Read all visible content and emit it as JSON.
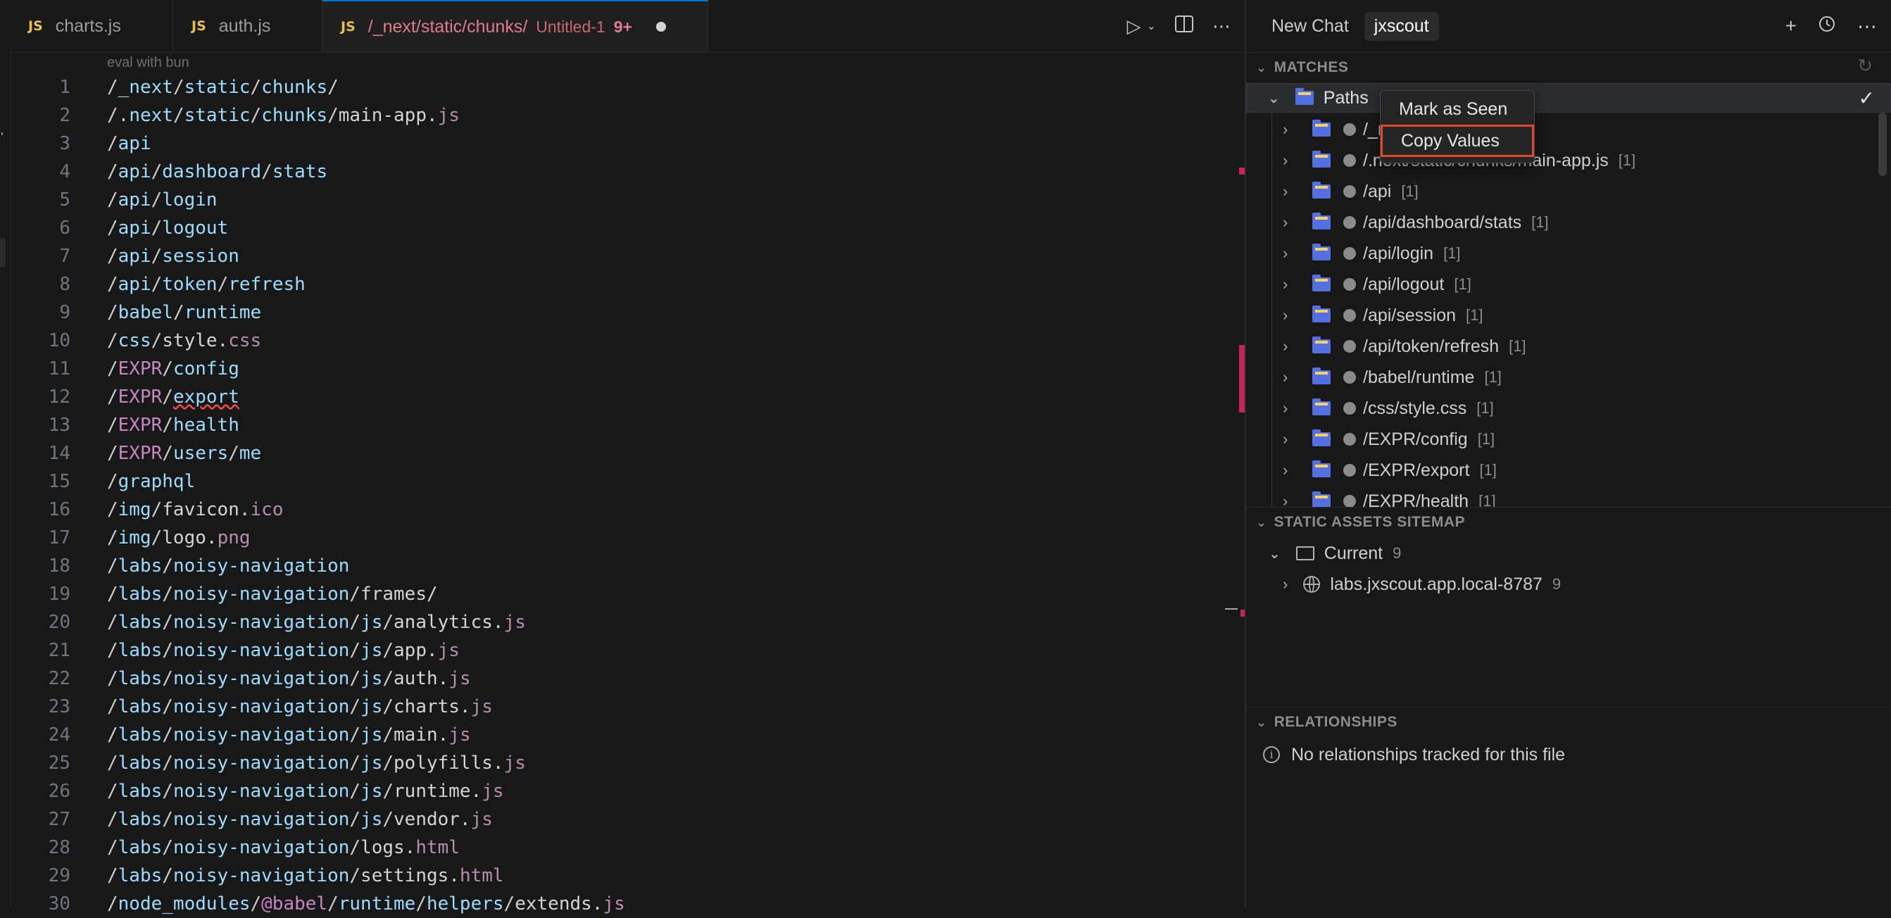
{
  "tabs": [
    {
      "label": "charts.js",
      "icon": "JS"
    },
    {
      "label": "auth.js",
      "icon": "JS"
    },
    {
      "label": "/_next/static/chunks/",
      "sub": "Untitled-1",
      "badge": "9+",
      "icon": "JS"
    }
  ],
  "editor": {
    "hint": "eval with bun",
    "lines": [
      {
        "n": "1",
        "segs": [
          [
            "slash",
            "/"
          ],
          [
            "seg",
            "_next"
          ],
          [
            "slash",
            "/"
          ],
          [
            "seg",
            "static"
          ],
          [
            "slash",
            "/"
          ],
          [
            "seg",
            "chunks"
          ],
          [
            "slash",
            "/"
          ]
        ]
      },
      {
        "n": "2",
        "segs": [
          [
            "slash",
            "/."
          ],
          [
            "seg",
            "next"
          ],
          [
            "slash",
            "/"
          ],
          [
            "seg",
            "static"
          ],
          [
            "slash",
            "/"
          ],
          [
            "seg",
            "chunks"
          ],
          [
            "slash",
            "/"
          ],
          [
            "w",
            "main-app."
          ],
          [
            "ext",
            "js"
          ]
        ]
      },
      {
        "n": "3",
        "segs": [
          [
            "slash",
            "/"
          ],
          [
            "seg",
            "api"
          ]
        ]
      },
      {
        "n": "4",
        "segs": [
          [
            "slash",
            "/"
          ],
          [
            "seg",
            "api"
          ],
          [
            "slash",
            "/"
          ],
          [
            "seg",
            "dashboard"
          ],
          [
            "slash",
            "/"
          ],
          [
            "seg",
            "stats"
          ]
        ]
      },
      {
        "n": "5",
        "segs": [
          [
            "slash",
            "/"
          ],
          [
            "seg",
            "api"
          ],
          [
            "slash",
            "/"
          ],
          [
            "seg",
            "login"
          ]
        ]
      },
      {
        "n": "6",
        "segs": [
          [
            "slash",
            "/"
          ],
          [
            "seg",
            "api"
          ],
          [
            "slash",
            "/"
          ],
          [
            "seg",
            "logout"
          ]
        ]
      },
      {
        "n": "7",
        "segs": [
          [
            "slash",
            "/"
          ],
          [
            "seg",
            "api"
          ],
          [
            "slash",
            "/"
          ],
          [
            "seg",
            "session"
          ]
        ]
      },
      {
        "n": "8",
        "segs": [
          [
            "slash",
            "/"
          ],
          [
            "seg",
            "api"
          ],
          [
            "slash",
            "/"
          ],
          [
            "seg",
            "token"
          ],
          [
            "slash",
            "/"
          ],
          [
            "seg",
            "refresh"
          ]
        ]
      },
      {
        "n": "9",
        "segs": [
          [
            "slash",
            "/"
          ],
          [
            "seg",
            "babel"
          ],
          [
            "slash",
            "/"
          ],
          [
            "seg",
            "runtime"
          ]
        ]
      },
      {
        "n": "10",
        "segs": [
          [
            "slash",
            "/"
          ],
          [
            "seg",
            "css"
          ],
          [
            "slash",
            "/"
          ],
          [
            "w",
            "style."
          ],
          [
            "ext",
            "css"
          ]
        ]
      },
      {
        "n": "11",
        "segs": [
          [
            "slash",
            "/"
          ],
          [
            "p",
            "EXPR"
          ],
          [
            "slash",
            "/"
          ],
          [
            "seg",
            "config"
          ]
        ]
      },
      {
        "n": "12",
        "segs": [
          [
            "slash",
            "/"
          ],
          [
            "p",
            "EXPR"
          ],
          [
            "slash",
            "/"
          ],
          [
            "und",
            "export"
          ]
        ]
      },
      {
        "n": "13",
        "segs": [
          [
            "slash",
            "/"
          ],
          [
            "p",
            "EXPR"
          ],
          [
            "slash",
            "/"
          ],
          [
            "seg",
            "health"
          ]
        ]
      },
      {
        "n": "14",
        "segs": [
          [
            "slash",
            "/"
          ],
          [
            "p",
            "EXPR"
          ],
          [
            "slash",
            "/"
          ],
          [
            "seg",
            "users"
          ],
          [
            "slash",
            "/"
          ],
          [
            "seg",
            "me"
          ]
        ]
      },
      {
        "n": "15",
        "segs": [
          [
            "slash",
            "/"
          ],
          [
            "seg",
            "graphql"
          ]
        ]
      },
      {
        "n": "16",
        "segs": [
          [
            "slash",
            "/"
          ],
          [
            "seg",
            "img"
          ],
          [
            "slash",
            "/"
          ],
          [
            "w",
            "favicon."
          ],
          [
            "ext",
            "ico"
          ]
        ]
      },
      {
        "n": "17",
        "segs": [
          [
            "slash",
            "/"
          ],
          [
            "seg",
            "img"
          ],
          [
            "slash",
            "/"
          ],
          [
            "w",
            "logo."
          ],
          [
            "ext",
            "png"
          ]
        ]
      },
      {
        "n": "18",
        "segs": [
          [
            "slash",
            "/"
          ],
          [
            "seg",
            "labs"
          ],
          [
            "slash",
            "/"
          ],
          [
            "seg",
            "noisy-navigation"
          ]
        ]
      },
      {
        "n": "19",
        "segs": [
          [
            "slash",
            "/"
          ],
          [
            "seg",
            "labs"
          ],
          [
            "slash",
            "/"
          ],
          [
            "seg",
            "noisy-navigation"
          ],
          [
            "slash",
            "/"
          ],
          [
            "w",
            "frames/"
          ]
        ]
      },
      {
        "n": "20",
        "segs": [
          [
            "slash",
            "/"
          ],
          [
            "seg",
            "labs"
          ],
          [
            "slash",
            "/"
          ],
          [
            "seg",
            "noisy-navigation"
          ],
          [
            "slash",
            "/"
          ],
          [
            "seg",
            "js"
          ],
          [
            "slash",
            "/"
          ],
          [
            "w",
            "analytics."
          ],
          [
            "ext",
            "js"
          ]
        ]
      },
      {
        "n": "21",
        "segs": [
          [
            "slash",
            "/"
          ],
          [
            "seg",
            "labs"
          ],
          [
            "slash",
            "/"
          ],
          [
            "seg",
            "noisy-navigation"
          ],
          [
            "slash",
            "/"
          ],
          [
            "seg",
            "js"
          ],
          [
            "slash",
            "/"
          ],
          [
            "w",
            "app."
          ],
          [
            "ext",
            "js"
          ]
        ]
      },
      {
        "n": "22",
        "segs": [
          [
            "slash",
            "/"
          ],
          [
            "seg",
            "labs"
          ],
          [
            "slash",
            "/"
          ],
          [
            "seg",
            "noisy-navigation"
          ],
          [
            "slash",
            "/"
          ],
          [
            "seg",
            "js"
          ],
          [
            "slash",
            "/"
          ],
          [
            "w",
            "auth."
          ],
          [
            "ext",
            "js"
          ]
        ]
      },
      {
        "n": "23",
        "segs": [
          [
            "slash",
            "/"
          ],
          [
            "seg",
            "labs"
          ],
          [
            "slash",
            "/"
          ],
          [
            "seg",
            "noisy-navigation"
          ],
          [
            "slash",
            "/"
          ],
          [
            "seg",
            "js"
          ],
          [
            "slash",
            "/"
          ],
          [
            "w",
            "charts."
          ],
          [
            "ext",
            "js"
          ]
        ]
      },
      {
        "n": "24",
        "segs": [
          [
            "slash",
            "/"
          ],
          [
            "seg",
            "labs"
          ],
          [
            "slash",
            "/"
          ],
          [
            "seg",
            "noisy-navigation"
          ],
          [
            "slash",
            "/"
          ],
          [
            "seg",
            "js"
          ],
          [
            "slash",
            "/"
          ],
          [
            "w",
            "main."
          ],
          [
            "ext",
            "js"
          ]
        ]
      },
      {
        "n": "25",
        "segs": [
          [
            "slash",
            "/"
          ],
          [
            "seg",
            "labs"
          ],
          [
            "slash",
            "/"
          ],
          [
            "seg",
            "noisy-navigation"
          ],
          [
            "slash",
            "/"
          ],
          [
            "seg",
            "js"
          ],
          [
            "slash",
            "/"
          ],
          [
            "w",
            "polyfills."
          ],
          [
            "ext",
            "js"
          ]
        ]
      },
      {
        "n": "26",
        "segs": [
          [
            "slash",
            "/"
          ],
          [
            "seg",
            "labs"
          ],
          [
            "slash",
            "/"
          ],
          [
            "seg",
            "noisy-navigation"
          ],
          [
            "slash",
            "/"
          ],
          [
            "seg",
            "js"
          ],
          [
            "slash",
            "/"
          ],
          [
            "w",
            "runtime."
          ],
          [
            "ext",
            "js"
          ]
        ]
      },
      {
        "n": "27",
        "segs": [
          [
            "slash",
            "/"
          ],
          [
            "seg",
            "labs"
          ],
          [
            "slash",
            "/"
          ],
          [
            "seg",
            "noisy-navigation"
          ],
          [
            "slash",
            "/"
          ],
          [
            "seg",
            "js"
          ],
          [
            "slash",
            "/"
          ],
          [
            "w",
            "vendor."
          ],
          [
            "ext",
            "js"
          ]
        ]
      },
      {
        "n": "28",
        "segs": [
          [
            "slash",
            "/"
          ],
          [
            "seg",
            "labs"
          ],
          [
            "slash",
            "/"
          ],
          [
            "seg",
            "noisy-navigation"
          ],
          [
            "slash",
            "/"
          ],
          [
            "w",
            "logs."
          ],
          [
            "ext",
            "html"
          ]
        ]
      },
      {
        "n": "29",
        "segs": [
          [
            "slash",
            "/"
          ],
          [
            "seg",
            "labs"
          ],
          [
            "slash",
            "/"
          ],
          [
            "seg",
            "noisy-navigation"
          ],
          [
            "slash",
            "/"
          ],
          [
            "w",
            "settings."
          ],
          [
            "ext",
            "html"
          ]
        ]
      },
      {
        "n": "30",
        "segs": [
          [
            "slash",
            "/"
          ],
          [
            "seg",
            "node_modules"
          ],
          [
            "slash",
            "/"
          ],
          [
            "p",
            "@babel"
          ],
          [
            "slash",
            "/"
          ],
          [
            "seg",
            "runtime"
          ],
          [
            "slash",
            "/"
          ],
          [
            "seg",
            "helpers"
          ],
          [
            "slash",
            "/"
          ],
          [
            "w",
            "extends."
          ],
          [
            "ext",
            "js"
          ]
        ]
      }
    ]
  },
  "panel": {
    "tab_new_chat": "New Chat",
    "tab_active": "jxscout",
    "matches_header": "MATCHES",
    "root_label": "Paths",
    "rows": [
      {
        "label": "/_n",
        "count": "[1]"
      },
      {
        "label": "/.next/static/chunks/main-app.js",
        "count": "[1]"
      },
      {
        "label": "/api",
        "count": "[1]"
      },
      {
        "label": "/api/dashboard/stats",
        "count": "[1]"
      },
      {
        "label": "/api/login",
        "count": "[1]"
      },
      {
        "label": "/api/logout",
        "count": "[1]"
      },
      {
        "label": "/api/session",
        "count": "[1]"
      },
      {
        "label": "/api/token/refresh",
        "count": "[1]"
      },
      {
        "label": "/babel/runtime",
        "count": "[1]"
      },
      {
        "label": "/css/style.css",
        "count": "[1]"
      },
      {
        "label": "/EXPR/config",
        "count": "[1]"
      },
      {
        "label": "/EXPR/export",
        "count": "[1]"
      },
      {
        "label": "/EXPR/health",
        "count": "[1]"
      }
    ],
    "sitemap_header": "STATIC ASSETS SITEMAP",
    "current_label": "Current",
    "current_count": "9",
    "site_label": "labs.jxscout.app.local-8787",
    "site_count": "9",
    "relationships_header": "RELATIONSHIPS",
    "relationships_empty": "No relationships tracked for this file"
  },
  "context_menu": {
    "mark_seen": "Mark as Seen",
    "copy_values": "Copy Values"
  },
  "colors": {
    "accent_highlight": "#e0482b",
    "minimap_mark": "#c5265a"
  }
}
